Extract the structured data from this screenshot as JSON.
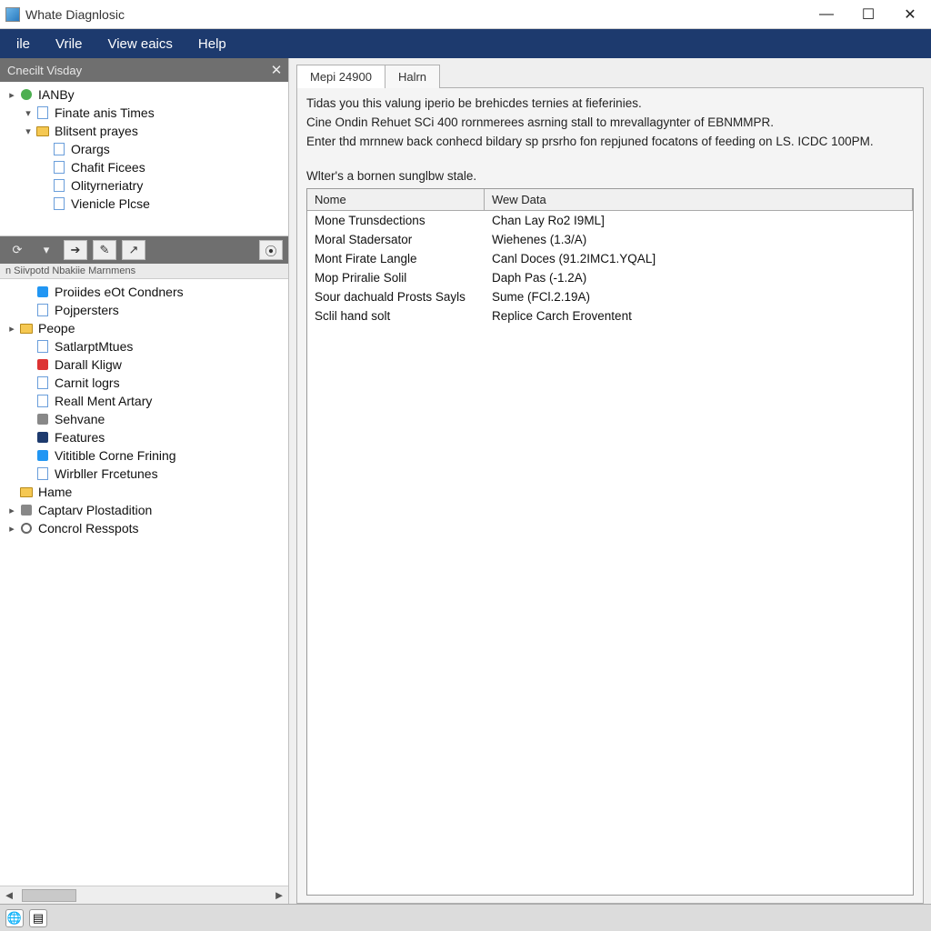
{
  "window": {
    "title": "Whate Diagnlosic"
  },
  "menu": {
    "file": "ile",
    "vrile": "Vrile",
    "view": "View eaics",
    "help": "Help"
  },
  "sidebar": {
    "panel_title": "Cnecilt Visday",
    "upper": [
      {
        "label": "IANBy",
        "icon": "green-icon",
        "depth": 1,
        "twist": "▸"
      },
      {
        "label": "Finate anis Times",
        "icon": "doc-icon",
        "depth": 2,
        "twist": "▾"
      },
      {
        "label": "Blitsent prayes",
        "icon": "folder-icon",
        "depth": 2,
        "twist": "▾"
      },
      {
        "label": "Orargs",
        "icon": "doc-icon",
        "depth": 3,
        "twist": ""
      },
      {
        "label": "Chafit Ficees",
        "icon": "doc-icon",
        "depth": 3,
        "twist": ""
      },
      {
        "label": "Olityrneriatry",
        "icon": "doc-icon",
        "depth": 3,
        "twist": ""
      },
      {
        "label": "Vienicle Plcse",
        "icon": "doc-icon",
        "depth": 3,
        "twist": ""
      }
    ],
    "sub_header": "n Siivpotd Nbakiie Marnmens",
    "lower": [
      {
        "label": "Proiides eOt Condners",
        "icon": "blue-icon",
        "depth": 2,
        "twist": ""
      },
      {
        "label": "Pojpersters",
        "icon": "doc-icon",
        "depth": 2,
        "twist": ""
      },
      {
        "label": "Peope",
        "icon": "folder-icon",
        "depth": 1,
        "twist": "▸"
      },
      {
        "label": "SatlarptMtues",
        "icon": "doc-icon",
        "depth": 2,
        "twist": ""
      },
      {
        "label": "Darall Kligw",
        "icon": "red-icon",
        "depth": 2,
        "twist": ""
      },
      {
        "label": "Carnit logrs",
        "icon": "doc-icon",
        "depth": 2,
        "twist": ""
      },
      {
        "label": "Reall Ment Artary",
        "icon": "doc-icon",
        "depth": 2,
        "twist": ""
      },
      {
        "label": "Sehvane",
        "icon": "gray-icon",
        "depth": 2,
        "twist": ""
      },
      {
        "label": "Features",
        "icon": "darkblue-icon",
        "depth": 2,
        "twist": ""
      },
      {
        "label": "Vititible Corne Frining",
        "icon": "blue-icon",
        "depth": 2,
        "twist": ""
      },
      {
        "label": "Wirbller Frcetunes",
        "icon": "doc-icon",
        "depth": 2,
        "twist": ""
      },
      {
        "label": "Hame",
        "icon": "folder-icon",
        "depth": 1,
        "twist": ""
      },
      {
        "label": "Captarv Plostadition",
        "icon": "gray-icon",
        "depth": 1,
        "twist": "▸"
      },
      {
        "label": "Concrol Resspots",
        "icon": "gear-icon",
        "depth": 1,
        "twist": "▸"
      }
    ]
  },
  "content": {
    "tabs": [
      {
        "label": "Mepi 24900",
        "active": true
      },
      {
        "label": "Halrn",
        "active": false
      }
    ],
    "description": [
      "Tidas you this valung iperio be brehicdes ternies at fieferinies.",
      "Cine Ondin Rehuet SCi 400 rornmerees asrning stall to mrevallagynter of EBNMMPR.",
      "Enter thd mrnnew back conhecd bildary sp prsrho fon repjuned focatons of feeding on LS. ICDC 100PM."
    ],
    "caption": "Wlter's a bornen sunglbw stale.",
    "columns": {
      "name": "Nome",
      "data": "Wew Data"
    },
    "rows": [
      {
        "name": "Mone Trunsdections",
        "data": "Chan Lay Ro2 I9ML]"
      },
      {
        "name": "Moral Stadersator",
        "data": "Wiehenes (1.3/A)"
      },
      {
        "name": "Mont Firate Langle",
        "data": "Canl Doces (91.2IMC1.YQAL]"
      },
      {
        "name": "Mop Priralie Solil",
        "data": "Daph Pas (-1.2A)"
      },
      {
        "name": "Sour dachuald Prosts Sayls",
        "data": "Sume (FCl.2.19A)"
      },
      {
        "name": "Sclil hand solt",
        "data": "Replice Carch Eroventent"
      }
    ]
  }
}
